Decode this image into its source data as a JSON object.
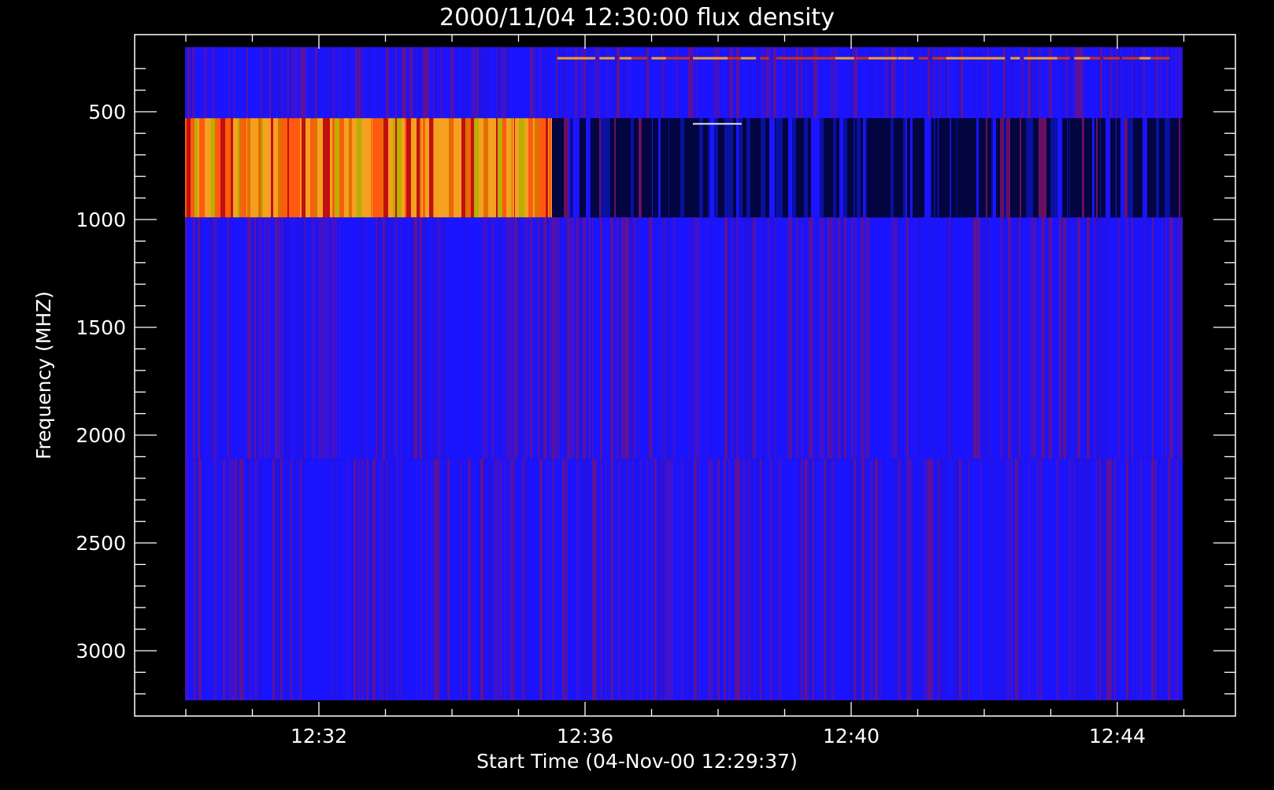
{
  "chart_data": {
    "type": "heatmap",
    "title": "2000/11/04 12:30:00 flux density",
    "xlabel": "Start Time (04-Nov-00 12:29:37)",
    "ylabel": "Frequency (MHZ)",
    "x_start": "12:29:37",
    "x_range_minutes": [
      29.6,
      45.0
    ],
    "x_ticks": [
      {
        "label": "12:32",
        "minute": 32
      },
      {
        "label": "12:36",
        "minute": 36
      },
      {
        "label": "12:40",
        "minute": 40
      },
      {
        "label": "12:44",
        "minute": 44
      }
    ],
    "y_range": [
      3300,
      160
    ],
    "y_reversed": true,
    "y_ticks": [
      500,
      1000,
      1500,
      2000,
      2500,
      3000
    ],
    "frequency_bands_mhz": [
      {
        "band": [
          200,
          530
        ],
        "level": "low",
        "note": "mostly blue, with narrow bright bursts near 250 MHz"
      },
      {
        "band": [
          530,
          990
        ],
        "level": "high then low",
        "note": "strong orange/yellow emission from 12:29:37 to about 12:35:30, then dark"
      },
      {
        "band": [
          990,
          2110
        ],
        "level": "low"
      },
      {
        "band": [
          2110,
          3230
        ],
        "level": "low"
      }
    ],
    "colors": {
      "background": "#000000",
      "low": "#1a14ff",
      "mid": "#c01010",
      "high": "#f5a020",
      "dark": "#020540"
    }
  }
}
